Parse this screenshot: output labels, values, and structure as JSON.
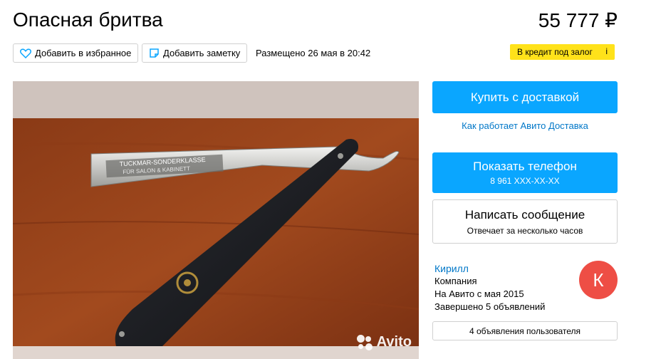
{
  "listing": {
    "title": "Опасная бритва",
    "price": "55 777 ₽",
    "posted": "Размещено 26 мая в 20:42"
  },
  "actions": {
    "favorite_label": "Добавить в избранное",
    "note_label": "Добавить заметку"
  },
  "credit": {
    "label": "В кредит под залог",
    "info": "i"
  },
  "photo": {
    "blade_text_1": "TUCKMAR-SONDERKLASSE",
    "blade_text_2": "FÜR SALON & KABINETT",
    "watermark": "Avito"
  },
  "buy": {
    "button_label": "Купить с доставкой",
    "how_link": "Как работает Авито Доставка"
  },
  "phone": {
    "button_label": "Показать телефон",
    "number": "8 961 XXX-XX-XX"
  },
  "message": {
    "button_label": "Написать сообщение",
    "response_time": "Отвечает за несколько часов"
  },
  "seller": {
    "name": "Кирилл",
    "type": "Компания",
    "since": "На Авито с мая 2015",
    "completed": "Завершено 5 объявлений",
    "avatar_letter": "К",
    "avatar_color": "#ee4e45"
  },
  "user_ads": {
    "label": "4 объявления пользователя"
  },
  "colors": {
    "accent_blue": "#0aa6ff",
    "link_blue": "#0077c8",
    "credit_yellow": "#ffe21a"
  }
}
